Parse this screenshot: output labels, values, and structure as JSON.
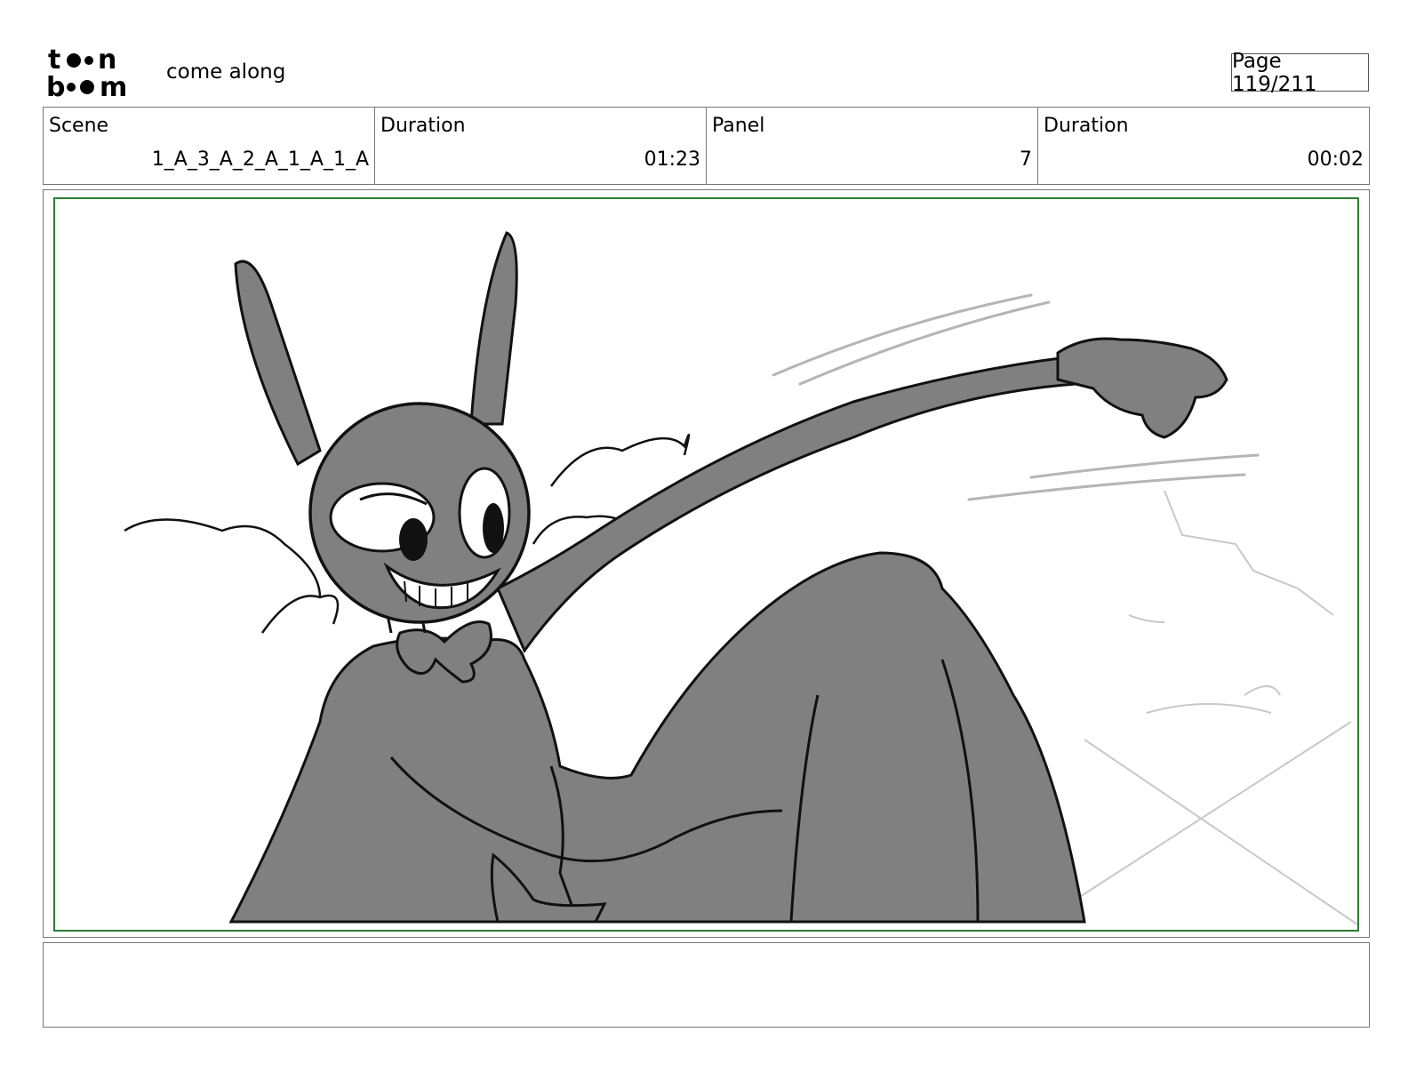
{
  "header": {
    "logo_text": "toon boom",
    "project_title": "come along",
    "page_label": "Page 119/211"
  },
  "info": {
    "scene_label": "Scene",
    "scene_value": "1_A_3_A_2_A_1_A_1_A",
    "scene_duration_label": "Duration",
    "scene_duration_value": "01:23",
    "panel_label": "Panel",
    "panel_value": "7",
    "panel_duration_label": "Duration",
    "panel_duration_value": "00:02"
  },
  "panel": {
    "image": "storyboard-sketch-rabbit-character-reaching-arm",
    "safe_frame_color": "#2e7d32",
    "fill_color": "#808080"
  },
  "notes": {
    "text": ""
  }
}
